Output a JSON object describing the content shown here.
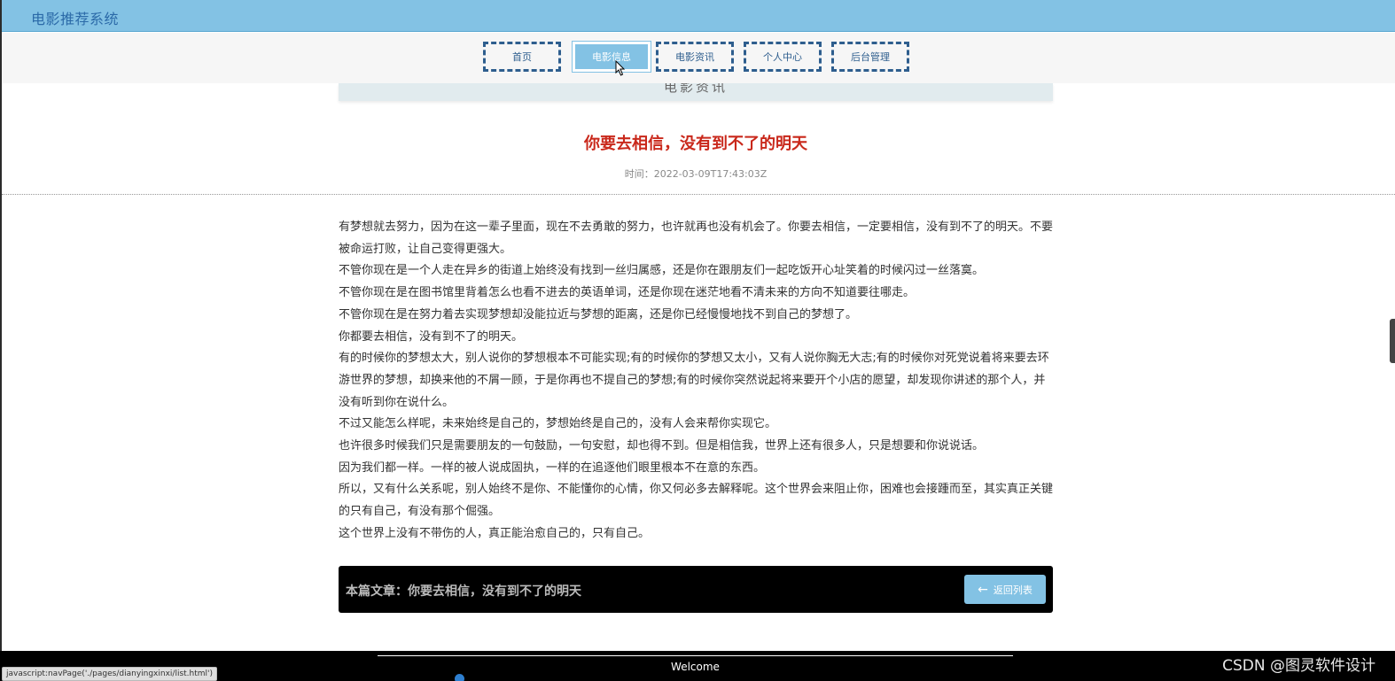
{
  "header": {
    "site_title": "电影推荐系统"
  },
  "nav": {
    "items": [
      {
        "label": "首页"
      },
      {
        "label": "电影信息"
      },
      {
        "label": "电影资讯"
      },
      {
        "label": "个人中心"
      },
      {
        "label": "后台管理"
      }
    ],
    "active_index": 1
  },
  "section": {
    "title": "电影资讯"
  },
  "article": {
    "title": "你要去相信，没有到不了的明天",
    "time": "时间：2022-03-09T17:43:03Z",
    "paragraphs": [
      "有梦想就去努力，因为在这一辈子里面，现在不去勇敢的努力，也许就再也没有机会了。你要去相信，一定要相信，没有到不了的明天。不要被命运打败，让自己变得更强大。",
      "不管你现在是一个人走在异乡的街道上始终没有找到一丝归属感，还是你在跟朋友们一起吃饭开心址笑着的时候闪过一丝落寞。",
      "不管你现在是在图书馆里背着怎么也看不进去的英语单词，还是你现在迷茫地看不清未来的方向不知道要往哪走。",
      "不管你现在是在努力着去实现梦想却没能拉近与梦想的距离，还是你已经慢慢地找不到自己的梦想了。",
      "你都要去相信，没有到不了的明天。",
      "有的时候你的梦想太大，别人说你的梦想根本不可能实现;有的时候你的梦想又太小，又有人说你胸无大志;有的时候你对死党说着将来要去环游世界的梦想，却换来他的不屑一顾，于是你再也不提自己的梦想;有的时候你突然说起将来要开个小店的愿望，却发现你讲述的那个人，并没有听到你在说什么。",
      "不过又能怎么样呢，未来始终是自己的，梦想始终是自己的，没有人会来帮你实现它。",
      "也许很多时候我们只是需要朋友的一句鼓励，一句安慰，却也得不到。但是相信我，世界上还有很多人，只是想要和你说说话。",
      "因为我们都一样。一样的被人说成固执，一样的在追逐他们眼里根本不在意的东西。",
      "所以，又有什么关系呢，别人始终不是你、不能懂你的心情，你又何必多去解释呢。这个世界会来阻止你，困难也会接踵而至，其实真正关键的只有自己，有没有那个倔强。",
      "这个世界上没有不带伤的人，真正能治愈自己的，只有自己。"
    ],
    "footer_label": "本篇文章：你要去相信，没有到不了的明天",
    "back_label": "返回列表"
  },
  "bottom": {
    "welcome": "Welcome",
    "status_url": "javascript:navPage('./pages/dianyingxinxi/list.html')",
    "watermark": "CSDN @图灵软件设计"
  },
  "colors": {
    "primary": "#83c2e4",
    "nav_border": "#2e5e8e",
    "title_red": "#c9281b"
  }
}
